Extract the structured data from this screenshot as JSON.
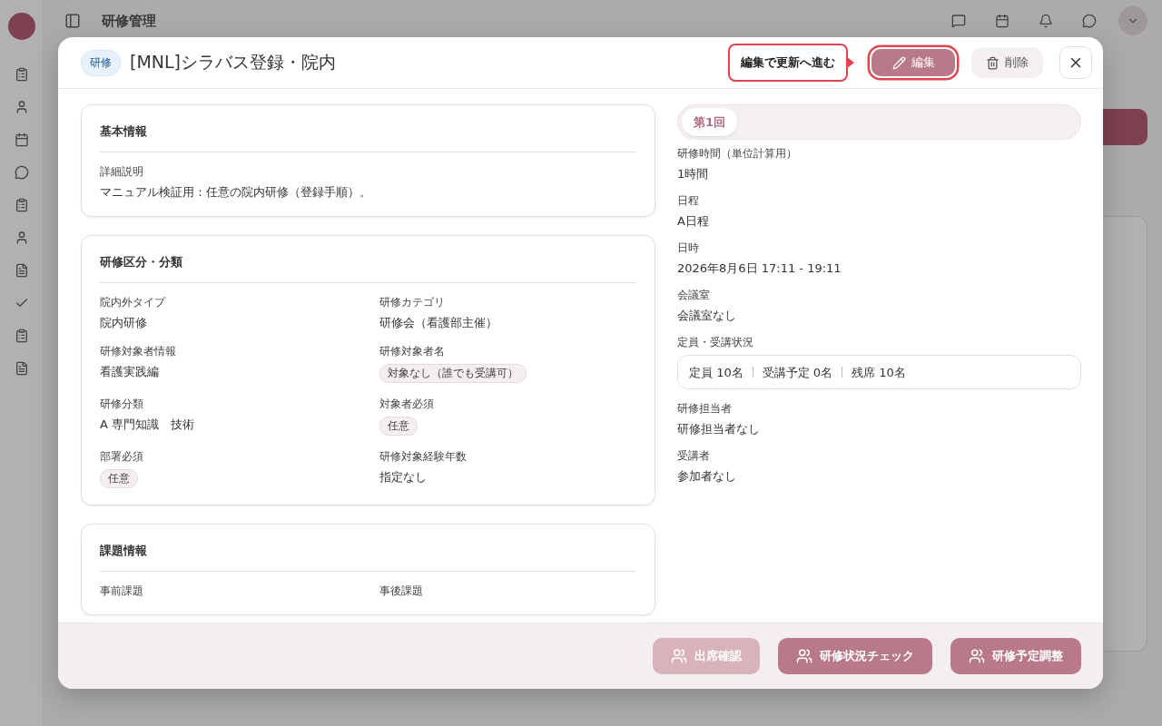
{
  "backdrop": {
    "title": "研修管理"
  },
  "modal": {
    "badge": "研修",
    "title": "[MNL]シラバス登録・院内",
    "hint": "編集で更新へ進む",
    "actions": [
      {
        "label": "編集",
        "kind": "primary",
        "highlighted": true
      },
      {
        "label": "削除",
        "kind": "secondary",
        "highlighted": false
      }
    ]
  },
  "sections": [
    {
      "title": "基本情報",
      "fields": [
        {
          "label": "詳細説明",
          "value": "マニュアル検証用：任意の院内研修（登録手順）。",
          "kind": "text"
        }
      ]
    },
    {
      "title": "研修区分・分類",
      "fields": [
        {
          "label": "院内外タイプ",
          "value": "院内研修",
          "kind": "text"
        },
        {
          "label": "研修カテゴリ",
          "value": "研修会（看護部主催）",
          "kind": "text"
        },
        {
          "label": "研修対象者情報",
          "value": "看護実践編",
          "kind": "text"
        },
        {
          "label": "研修対象者名",
          "value": "対象なし（誰でも受講可）",
          "kind": "chip"
        },
        {
          "label": "研修分類",
          "value": "A 専門知識　技術",
          "kind": "text"
        },
        {
          "label": "対象者必須",
          "value": "任意",
          "kind": "chip"
        },
        {
          "label": "部署必須",
          "value": "任意",
          "kind": "chip"
        },
        {
          "label": "研修対象経験年数",
          "value": "指定なし",
          "kind": "text"
        }
      ]
    },
    {
      "title": "課題情報",
      "fields": [
        {
          "label": "事前課題",
          "kind": "text"
        },
        {
          "label": "事後課題",
          "kind": "text"
        }
      ]
    }
  ],
  "sessions": {
    "tabs": [
      {
        "label": "第1回",
        "selected": true
      }
    ],
    "fields": [
      {
        "label": "研修時間（単位計算用）",
        "value": "1時間",
        "kind": "text"
      },
      {
        "label": "日程",
        "value": "A日程",
        "kind": "text"
      },
      {
        "label": "日時",
        "value": "2026年8月6日 17:11 - 19:11",
        "kind": "text"
      },
      {
        "label": "会議室",
        "value": "会議室なし",
        "kind": "text"
      },
      {
        "label": "定員・受講状況",
        "parts": [
          "定員 10名",
          "受講予定 0名",
          "残席 10名"
        ],
        "kind": "summary"
      },
      {
        "label": "研修担当者",
        "value": "研修担当者なし",
        "kind": "text"
      },
      {
        "label": "受講者",
        "value": "参加者なし",
        "kind": "text"
      }
    ]
  },
  "footer": {
    "buttons": [
      {
        "label": "出席確認",
        "disabled": true
      },
      {
        "label": "研修状況チェック",
        "disabled": false
      },
      {
        "label": "研修予定調整",
        "disabled": false
      }
    ]
  }
}
